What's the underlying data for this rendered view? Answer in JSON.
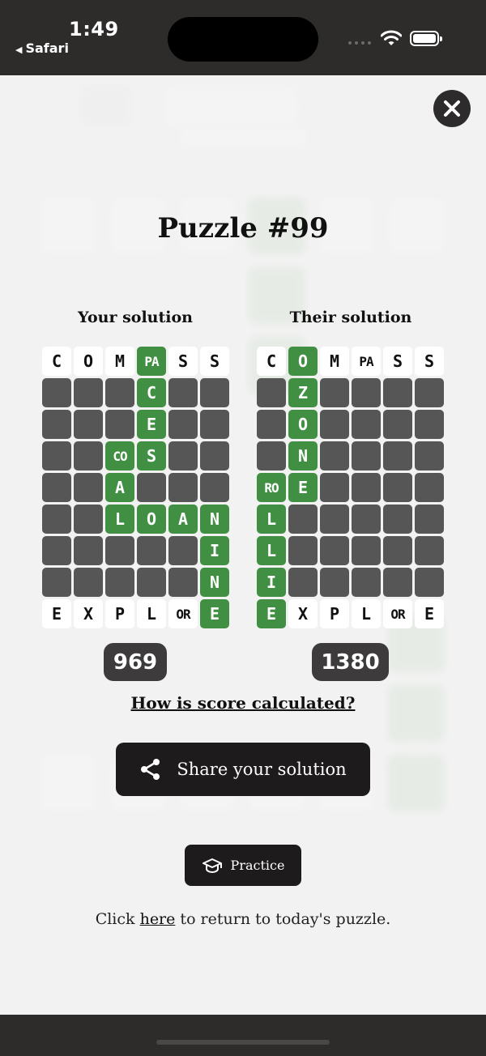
{
  "status_bar": {
    "time": "1:49",
    "back_app": "Safari"
  },
  "modal": {
    "title": "Puzzle #99",
    "your": {
      "heading": "Your solution",
      "score": "969",
      "grid": [
        [
          [
            "C",
            "w"
          ],
          [
            "O",
            "w"
          ],
          [
            "M",
            "w"
          ],
          [
            "PA",
            "g"
          ],
          [
            "S",
            "w"
          ],
          [
            "S",
            "w"
          ]
        ],
        [
          [
            "",
            "d"
          ],
          [
            "",
            "d"
          ],
          [
            "",
            "d"
          ],
          [
            "C",
            "g"
          ],
          [
            "",
            "d"
          ],
          [
            "",
            "d"
          ]
        ],
        [
          [
            "",
            "d"
          ],
          [
            "",
            "d"
          ],
          [
            "",
            "d"
          ],
          [
            "E",
            "g"
          ],
          [
            "",
            "d"
          ],
          [
            "",
            "d"
          ]
        ],
        [
          [
            "",
            "d"
          ],
          [
            "",
            "d"
          ],
          [
            "CO",
            "g"
          ],
          [
            "S",
            "g"
          ],
          [
            "",
            "d"
          ],
          [
            "",
            "d"
          ]
        ],
        [
          [
            "",
            "d"
          ],
          [
            "",
            "d"
          ],
          [
            "A",
            "g"
          ],
          [
            "",
            "d"
          ],
          [
            "",
            "d"
          ],
          [
            "",
            "d"
          ]
        ],
        [
          [
            "",
            "d"
          ],
          [
            "",
            "d"
          ],
          [
            "L",
            "g"
          ],
          [
            "O",
            "g"
          ],
          [
            "A",
            "g"
          ],
          [
            "N",
            "g"
          ]
        ],
        [
          [
            "",
            "d"
          ],
          [
            "",
            "d"
          ],
          [
            "",
            "d"
          ],
          [
            "",
            "d"
          ],
          [
            "",
            "d"
          ],
          [
            "I",
            "g"
          ]
        ],
        [
          [
            "",
            "d"
          ],
          [
            "",
            "d"
          ],
          [
            "",
            "d"
          ],
          [
            "",
            "d"
          ],
          [
            "",
            "d"
          ],
          [
            "N",
            "g"
          ]
        ],
        [
          [
            "E",
            "w"
          ],
          [
            "X",
            "w"
          ],
          [
            "P",
            "w"
          ],
          [
            "L",
            "w"
          ],
          [
            "OR",
            "w"
          ],
          [
            "E",
            "g"
          ]
        ]
      ]
    },
    "their": {
      "heading": "Their solution",
      "score": "1380",
      "grid": [
        [
          [
            "C",
            "w"
          ],
          [
            "O",
            "g"
          ],
          [
            "M",
            "w"
          ],
          [
            "PA",
            "w"
          ],
          [
            "S",
            "w"
          ],
          [
            "S",
            "w"
          ]
        ],
        [
          [
            "",
            "d"
          ],
          [
            "Z",
            "g"
          ],
          [
            "",
            "d"
          ],
          [
            "",
            "d"
          ],
          [
            "",
            "d"
          ],
          [
            "",
            "d"
          ]
        ],
        [
          [
            "",
            "d"
          ],
          [
            "O",
            "g"
          ],
          [
            "",
            "d"
          ],
          [
            "",
            "d"
          ],
          [
            "",
            "d"
          ],
          [
            "",
            "d"
          ]
        ],
        [
          [
            "",
            "d"
          ],
          [
            "N",
            "g"
          ],
          [
            "",
            "d"
          ],
          [
            "",
            "d"
          ],
          [
            "",
            "d"
          ],
          [
            "",
            "d"
          ]
        ],
        [
          [
            "RO",
            "g"
          ],
          [
            "E",
            "g"
          ],
          [
            "",
            "d"
          ],
          [
            "",
            "d"
          ],
          [
            "",
            "d"
          ],
          [
            "",
            "d"
          ]
        ],
        [
          [
            "L",
            "g"
          ],
          [
            "",
            "d"
          ],
          [
            "",
            "d"
          ],
          [
            "",
            "d"
          ],
          [
            "",
            "d"
          ],
          [
            "",
            "d"
          ]
        ],
        [
          [
            "L",
            "g"
          ],
          [
            "",
            "d"
          ],
          [
            "",
            "d"
          ],
          [
            "",
            "d"
          ],
          [
            "",
            "d"
          ],
          [
            "",
            "d"
          ]
        ],
        [
          [
            "I",
            "g"
          ],
          [
            "",
            "d"
          ],
          [
            "",
            "d"
          ],
          [
            "",
            "d"
          ],
          [
            "",
            "d"
          ],
          [
            "",
            "d"
          ]
        ],
        [
          [
            "E",
            "g"
          ],
          [
            "X",
            "w"
          ],
          [
            "P",
            "w"
          ],
          [
            "L",
            "w"
          ],
          [
            "OR",
            "w"
          ],
          [
            "E",
            "w"
          ]
        ]
      ]
    },
    "how_link": "How is score calculated?",
    "share_label": "Share your solution",
    "practice_label": "Practice",
    "return_before": "Click ",
    "return_link": "here",
    "return_after": " to return to today's puzzle."
  },
  "icons": {
    "close": "close-icon",
    "share": "share-icon",
    "practice": "graduation-cap-icon"
  },
  "colors": {
    "green_tile": "#418f42",
    "dark_tile": "#565656",
    "button_bg": "#1d1b1b",
    "score_bg": "#3d3b3b"
  }
}
